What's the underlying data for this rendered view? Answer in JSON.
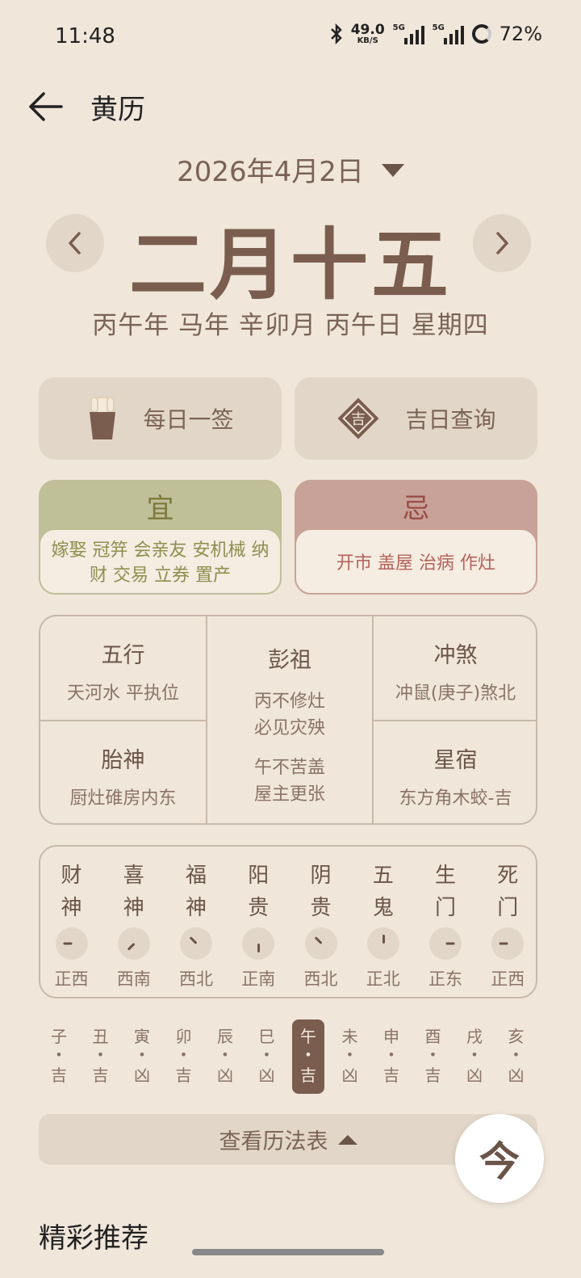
{
  "status_bar": {
    "time": "11:48",
    "net_speed_value": "49.0",
    "net_speed_unit": "KB/S",
    "sim1_tag": "5G",
    "sim2_tag": "5G",
    "battery": "72%"
  },
  "header": {
    "title": "黄历"
  },
  "date": {
    "gregorian": "2026年4月2日",
    "lunar": "二月十五",
    "ganzhi": "丙午年 马年 辛卯月 丙午日 星期四"
  },
  "quick_actions": {
    "daily_lot": "每日一签",
    "auspicious_day": "吉日查询",
    "auspicious_icon_char": "吉"
  },
  "yi": {
    "title": "宜",
    "items": "嫁娶 冠笄 会亲友 安机械 纳财 交易 立券 置产"
  },
  "ji": {
    "title": "忌",
    "items": "开市 盖屋 治病 作灶"
  },
  "info": {
    "wuxing": {
      "title": "五行",
      "value": "天河水 平执位"
    },
    "taishen": {
      "title": "胎神",
      "value": "厨灶碓房内东"
    },
    "pengzu": {
      "title": "彭祖",
      "line1": "丙不修灶",
      "line2": "必见灾殃",
      "line3": "午不苦盖",
      "line4": "屋主更张"
    },
    "chongsha": {
      "title": "冲煞",
      "value": "冲鼠(庚子)煞北"
    },
    "xingxiu": {
      "title": "星宿",
      "value": "东方角木蛟-吉"
    }
  },
  "directions": [
    {
      "god1": "财",
      "god2": "神",
      "direction": "正西",
      "angle": 270
    },
    {
      "god1": "喜",
      "god2": "神",
      "direction": "西南",
      "angle": 225
    },
    {
      "god1": "福",
      "god2": "神",
      "direction": "西北",
      "angle": 315
    },
    {
      "god1": "阳",
      "god2": "贵",
      "direction": "正南",
      "angle": 180
    },
    {
      "god1": "阴",
      "god2": "贵",
      "direction": "西北",
      "angle": 315
    },
    {
      "god1": "五",
      "god2": "鬼",
      "direction": "正北",
      "angle": 0
    },
    {
      "god1": "生",
      "god2": "门",
      "direction": "正东",
      "angle": 90
    },
    {
      "god1": "死",
      "god2": "门",
      "direction": "正西",
      "angle": 270
    }
  ],
  "hours": [
    {
      "branch": "子",
      "luck": "吉"
    },
    {
      "branch": "丑",
      "luck": "吉"
    },
    {
      "branch": "寅",
      "luck": "凶"
    },
    {
      "branch": "卯",
      "luck": "吉"
    },
    {
      "branch": "辰",
      "luck": "凶"
    },
    {
      "branch": "巳",
      "luck": "凶"
    },
    {
      "branch": "午",
      "luck": "吉"
    },
    {
      "branch": "未",
      "luck": "凶"
    },
    {
      "branch": "申",
      "luck": "吉"
    },
    {
      "branch": "酉",
      "luck": "吉"
    },
    {
      "branch": "戌",
      "luck": "凶"
    },
    {
      "branch": "亥",
      "luck": "凶"
    }
  ],
  "current_hour_index": 6,
  "bottom": {
    "almanac_table": "查看历法表",
    "today": "今",
    "recommend": "精彩推荐"
  }
}
